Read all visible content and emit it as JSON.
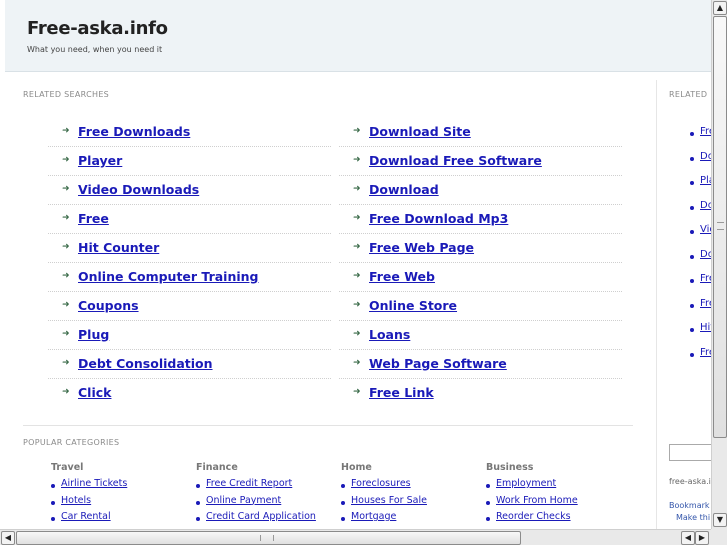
{
  "header": {
    "title": "Free-aska.info",
    "tagline": "What you need, when you need it"
  },
  "related_searches": {
    "heading": "RELATED SEARCHES",
    "left": [
      "Free Downloads",
      "Player",
      "Video Downloads",
      "Free",
      "Hit Counter",
      "Online Computer Training",
      "Coupons",
      "Plug",
      "Debt Consolidation",
      "Click"
    ],
    "right": [
      "Download Site",
      "Download Free Software",
      "Download",
      "Free Download Mp3",
      "Free Web Page",
      "Free Web",
      "Online Store",
      "Loans",
      "Web Page Software",
      "Free Link"
    ]
  },
  "popular_categories": {
    "heading": "POPULAR CATEGORIES",
    "categories": [
      {
        "title": "Travel",
        "links": [
          "Airline Tickets",
          "Hotels",
          "Car Rental"
        ]
      },
      {
        "title": "Finance",
        "links": [
          "Free Credit Report",
          "Online Payment",
          "Credit Card Application"
        ]
      },
      {
        "title": "Home",
        "links": [
          "Foreclosures",
          "Houses For Sale",
          "Mortgage"
        ]
      },
      {
        "title": "Business",
        "links": [
          "Employment",
          "Work From Home",
          "Reorder Checks"
        ]
      }
    ]
  },
  "sidebar": {
    "heading": "RELATED",
    "links": [
      "Fre",
      "Do",
      "Pla",
      "Do",
      "Vic",
      "Do",
      "Fre",
      "Fre",
      "Hit",
      "Fre"
    ],
    "domain_text": "free-aska.i",
    "bookmark_line1": "Bookmark",
    "bookmark_line2": "Make thi"
  },
  "scrollbars": {
    "up_arrow": "▲",
    "down_arrow": "▼",
    "left_arrow": "◀",
    "right_arrow": "▶"
  },
  "colors": {
    "link": "#1a1ab8",
    "header_bg": "#eef3f6",
    "arrow": "#3b6b4a"
  },
  "icons": {
    "row_bullet": "arrow-right-icon",
    "list_bullet": "dot-bullet-icon"
  }
}
